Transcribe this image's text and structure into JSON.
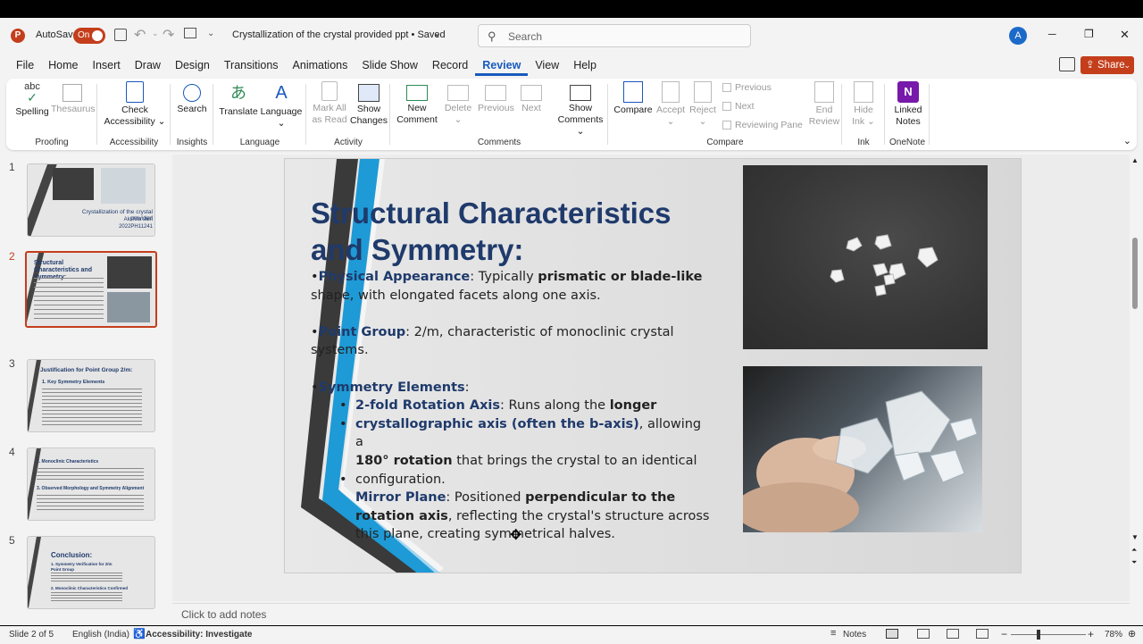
{
  "titlebar": {
    "autosave_label": "AutoSave",
    "autosave_state": "On",
    "doc_title": "Crystallization of the crystal provided ppt • Saved",
    "search_placeholder": "Search",
    "avatar_initial": "A",
    "minimize": "─",
    "restore": "❐",
    "close": "✕"
  },
  "menu": {
    "items": [
      "File",
      "Home",
      "Insert",
      "Draw",
      "Design",
      "Transitions",
      "Animations",
      "Slide Show",
      "Record",
      "Review",
      "View",
      "Help"
    ],
    "active": "Review",
    "share_label": "Share"
  },
  "ribbon": {
    "proofing": {
      "label": "Proofing",
      "spelling": "Spelling",
      "thesaurus": "Thesaurus"
    },
    "accessibility": {
      "label": "Accessibility",
      "check_line1": "Check",
      "check_line2": "Accessibility"
    },
    "insights": {
      "label": "Insights",
      "search": "Search"
    },
    "language": {
      "label": "Language",
      "translate": "Translate",
      "language": "Language"
    },
    "activity": {
      "label": "Activity",
      "mark_line1": "Mark All",
      "mark_line2": "as Read",
      "show_line1": "Show",
      "show_line2": "Changes"
    },
    "comments": {
      "label": "Comments",
      "new_line1": "New",
      "new_line2": "Comment",
      "delete": "Delete",
      "previous": "Previous",
      "next": "Next",
      "show_line1": "Show",
      "show_line2": "Comments"
    },
    "compare": {
      "label": "Compare",
      "compare": "Compare",
      "accept": "Accept",
      "reject": "Reject",
      "previous": "Previous",
      "next": "Next",
      "reviewing_pane": "Reviewing Pane",
      "end_line1": "End",
      "end_line2": "Review"
    },
    "ink": {
      "label": "Ink",
      "hide_line1": "Hide",
      "hide_line2": "Ink"
    },
    "onenote": {
      "label": "OneNote",
      "linked_line1": "Linked",
      "linked_line2": "Notes"
    }
  },
  "thumbnails": {
    "numbers": [
      "1",
      "2",
      "3",
      "4",
      "5"
    ],
    "t1": {
      "title": "Crystallization of the crystal provided",
      "author": "Akshita Jain",
      "id": "2022PH11241"
    },
    "t2": {
      "title": "Structural Characteristics and Symmetry:"
    },
    "t3": {
      "title": "Justification for Point Group 2/m:",
      "sub": "1. Key Symmetry Elements"
    },
    "t4": {
      "title": "2. Monoclinic Characteristics",
      "sub": "3. Observed Morphology and Symmetry Alignment"
    },
    "t5": {
      "title": "Conclusion:",
      "sub1": "1. Symmetry Verification for 2/m Point Group",
      "sub2": "2. Monoclinic Characteristics Confirmed"
    }
  },
  "slide": {
    "title_line1": "Structural Characteristics",
    "title_line2": "and Symmetry:",
    "pa_bullet": "•",
    "pa_label": "Physical Appearance",
    "pa_text1": ": Typically ",
    "pa_bold": "prismatic or blade-like",
    "pa_text2": "shape, with elongated facets along one axis.",
    "pg_label": "Point Group",
    "pg_text1": ": 2/m, characteristic of monoclinic crystal",
    "pg_text2": "systems.",
    "se_label": "Symmetry Elements",
    "se_colon": ":",
    "b1_label": "2-fold Rotation Axis",
    "b1_text": ": Runs along the ",
    "b1_bold": "longer",
    "b2_label": "crystallographic axis (often the b-axis)",
    "b2_text": ", allowing a",
    "b3_bold": "180° rotation",
    "b3_text": " that brings the crystal to an identical",
    "b4_text": "configuration.",
    "b5_label": "Mirror Plane",
    "b5_text": ": Positioned ",
    "b5_bold": "perpendicular to the",
    "b6_bold": "rotation axis",
    "b6_text": ", reflecting the crystal's structure across",
    "b7_text": "this plane, creating symmetrical halves."
  },
  "notes_placeholder": "Click to add notes",
  "status": {
    "slide_info": "Slide 2 of 5",
    "language": "English (India)",
    "accessibility": "Accessibility: Investigate",
    "notes": "Notes",
    "zoom": "78%"
  },
  "colors": {
    "accent": "#185abd",
    "title_blue": "#1f3a6b",
    "autosave_red": "#c43e1c",
    "share_red": "#c43e1c"
  }
}
